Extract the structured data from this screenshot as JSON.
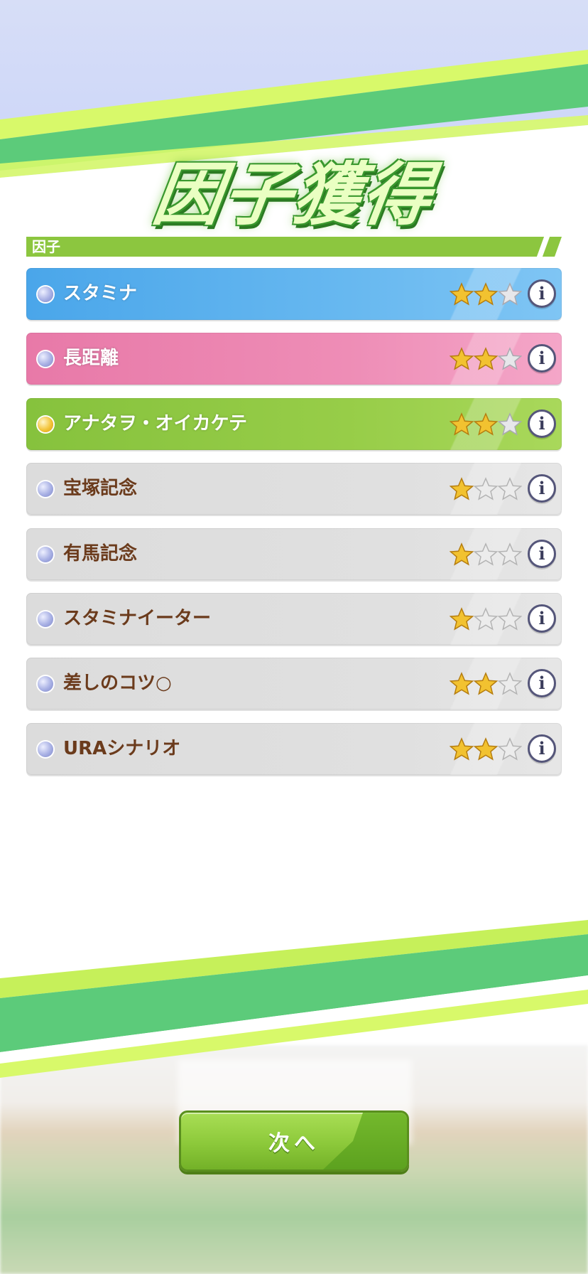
{
  "header": {
    "title": "因子獲得"
  },
  "section": {
    "label": "因子"
  },
  "factors": [
    {
      "name": "スタミナ",
      "color": "blue",
      "stars": 2,
      "dot": "blue"
    },
    {
      "name": "長距離",
      "color": "pink",
      "stars": 2,
      "dot": "blue"
    },
    {
      "name": "アナタヲ・オイカケテ",
      "color": "green",
      "stars": 2,
      "dot": "gold"
    },
    {
      "name": "宝塚記念",
      "color": "white",
      "stars": 1,
      "dot": "blue"
    },
    {
      "name": "有馬記念",
      "color": "white",
      "stars": 1,
      "dot": "blue"
    },
    {
      "name": "スタミナイーター",
      "color": "white",
      "stars": 1,
      "dot": "blue"
    },
    {
      "name": "差しのコツ○",
      "color": "white",
      "stars": 2,
      "dot": "blue"
    },
    {
      "name": "URAシナリオ",
      "color": "white",
      "stars": 2,
      "dot": "blue"
    }
  ],
  "star_max": 3,
  "info_icon": "info-icon",
  "next_button": {
    "label": "次へ"
  },
  "colors": {
    "accent_green": "#8cc63f",
    "blue_row": "#4aa6ea",
    "pink_row": "#e879a8",
    "green_row": "#86c23d",
    "white_row": "#dcdcdc",
    "name_brown": "#6b3b1c",
    "star_gold": "#f2c230"
  }
}
